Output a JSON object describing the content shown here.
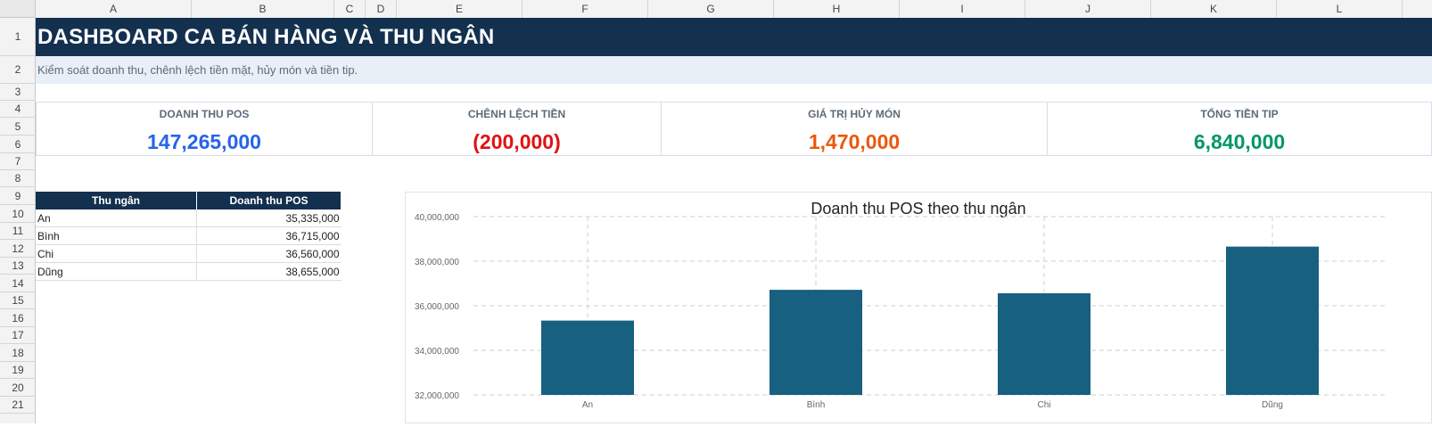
{
  "sheet": {
    "columns": [
      "A",
      "B",
      "C",
      "D",
      "E",
      "F",
      "G",
      "H",
      "I",
      "J",
      "K",
      "L"
    ],
    "rows": [
      "1",
      "2",
      "3",
      "4",
      "5",
      "6",
      "7",
      "8",
      "9",
      "10",
      "11",
      "12",
      "13",
      "14",
      "15",
      "16",
      "17",
      "18",
      "19",
      "20",
      "21"
    ]
  },
  "header": {
    "title": "DASHBOARD CA BÁN HÀNG VÀ THU NGÂN",
    "subtitle": "Kiểm soát doanh thu, chênh lệch tiền mặt, hủy món và tiền tip."
  },
  "kpis": [
    {
      "label": "DOANH THU POS",
      "value": "147,265,000",
      "color": "#2563eb"
    },
    {
      "label": "CHÊNH LỆCH TIỀN",
      "value": "(200,000)",
      "color": "#e01212"
    },
    {
      "label": "GIÁ TRỊ HỦY MÓN",
      "value": "1,470,000",
      "color": "#ea580c"
    },
    {
      "label": "TỔNG TIỀN TIP",
      "value": "6,840,000",
      "color": "#059669"
    }
  ],
  "table": {
    "headers": [
      "Thu ngân",
      "Doanh thu POS"
    ],
    "rows": [
      [
        "An",
        "35,335,000"
      ],
      [
        "Bình",
        "36,715,000"
      ],
      [
        "Chi",
        "36,560,000"
      ],
      [
        "Dũng",
        "38,655,000"
      ]
    ]
  },
  "chart_data": {
    "type": "bar",
    "title": "Doanh thu POS theo thu ngân",
    "categories": [
      "An",
      "Bình",
      "Chi",
      "Dũng"
    ],
    "values": [
      35335000,
      36715000,
      36560000,
      38655000
    ],
    "ylim": [
      32000000,
      40000000
    ],
    "yticks": [
      "32,000,000",
      "34,000,000",
      "36,000,000",
      "38,000,000",
      "40,000,000"
    ],
    "grid": true,
    "bar_color": "#17607f"
  }
}
